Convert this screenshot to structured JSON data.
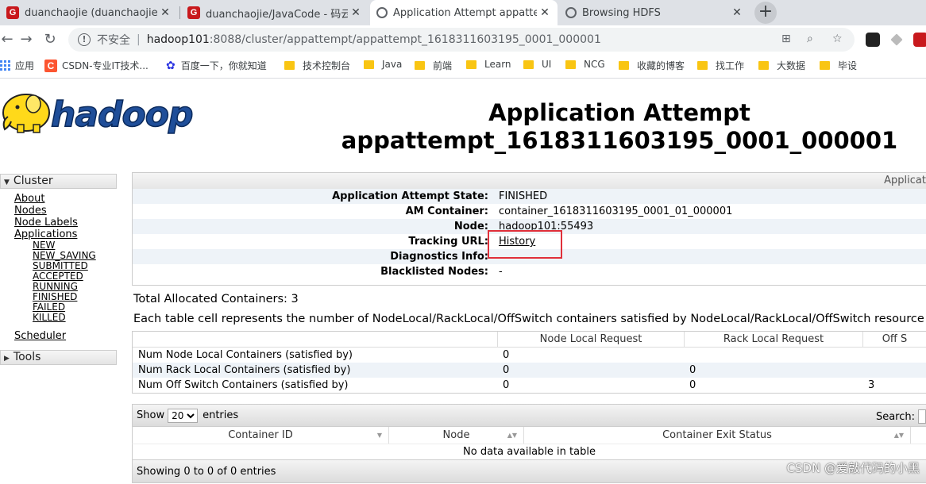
{
  "browser": {
    "tabs": [
      {
        "title": "duanchaojie (duanchaojie) - G",
        "favicon": "gitee-icon",
        "active": false
      },
      {
        "title": "duanchaojie/JavaCode - 码云 -",
        "favicon": "gitee-icon",
        "active": false
      },
      {
        "title": "Application Attempt appatter",
        "favicon": "globe-icon",
        "active": true
      },
      {
        "title": "Browsing HDFS",
        "favicon": "globe-icon",
        "active": false
      }
    ],
    "favicon_letter": "G",
    "close_glyph": "✕",
    "newtab_glyph": "+",
    "security_text": "不安全",
    "url_host": "hadoop101",
    "url_path": ":8088/cluster/appattempt/appattempt_1618311603195_0001_000001"
  },
  "bookmarks": {
    "apps_label": "应用",
    "csdn_icon_letter": "C",
    "items": [
      {
        "label": "CSDN-专业IT技术...",
        "icon": "csdn-icon"
      },
      {
        "label": "百度一下，你就知道",
        "icon": "baidu-icon"
      },
      {
        "label": "技术控制台",
        "icon": "folder-icon"
      },
      {
        "label": "Java",
        "icon": "folder-icon"
      },
      {
        "label": "前端",
        "icon": "folder-icon"
      },
      {
        "label": "Learn",
        "icon": "folder-icon"
      },
      {
        "label": "UI",
        "icon": "folder-icon"
      },
      {
        "label": "NCG",
        "icon": "folder-icon"
      },
      {
        "label": "收藏的博客",
        "icon": "folder-icon"
      },
      {
        "label": "找工作",
        "icon": "folder-icon"
      },
      {
        "label": "大数据",
        "icon": "folder-icon"
      },
      {
        "label": "毕设",
        "icon": "folder-icon"
      }
    ]
  },
  "page": {
    "title_line1": "Application Attempt",
    "title_line2": "appattempt_1618311603195_0001_000001",
    "logo_text": "hadoop"
  },
  "nav": {
    "cluster_label": "Cluster",
    "links": [
      "About",
      "Nodes",
      "Node Labels",
      "Applications"
    ],
    "app_states": [
      "NEW",
      "NEW_SAVING",
      "SUBMITTED",
      "ACCEPTED",
      "RUNNING",
      "FINISHED",
      "FAILED",
      "KILLED"
    ],
    "scheduler": "Scheduler",
    "tools_label": "Tools"
  },
  "info": {
    "header": "Applicat",
    "rows": [
      {
        "label": "Application Attempt State:",
        "value": "FINISHED"
      },
      {
        "label": "AM Container:",
        "value": "container_1618311603195_0001_01_000001"
      },
      {
        "label": "Node:",
        "value": "hadoop101:55493"
      },
      {
        "label": "Tracking URL:",
        "value": "History"
      },
      {
        "label": "Diagnostics Info:",
        "value": ""
      },
      {
        "label": "Blacklisted Nodes:",
        "value": "-"
      }
    ]
  },
  "allocation": {
    "total": "Total Allocated Containers: 3",
    "description": "Each table cell represents the number of NodeLocal/RackLocal/OffSwitch containers satisfied by NodeLocal/RackLocal/OffSwitch resource",
    "headers": [
      "",
      "Node Local Request",
      "Rack Local Request",
      "Off S"
    ],
    "rows": [
      [
        "Num Node Local Containers (satisfied by)",
        "0",
        "",
        ""
      ],
      [
        "Num Rack Local Containers (satisfied by)",
        "0",
        "0",
        ""
      ],
      [
        "Num Off Switch Containers (satisfied by)",
        "0",
        "0",
        "3"
      ]
    ]
  },
  "datatable": {
    "show_label": "Show",
    "page_size": "20",
    "entries_label": "entries",
    "search_label": "Search:",
    "columns": [
      "Container ID",
      "Node",
      "Container Exit Status"
    ],
    "sort_glyph": "▲▼",
    "empty_text": "No data available in table",
    "footer": "Showing 0 to 0 of 0 entries"
  },
  "watermark": "CSDN @爱敲代码的小黑"
}
